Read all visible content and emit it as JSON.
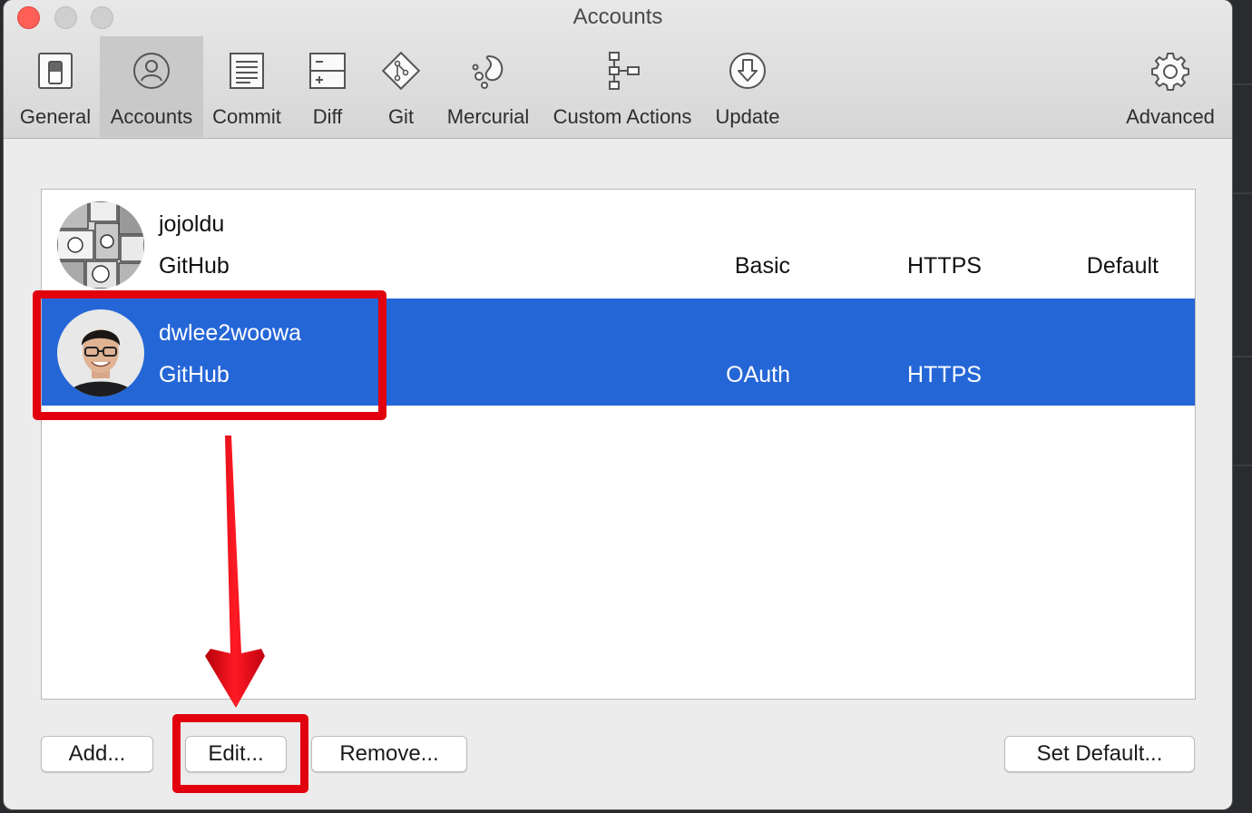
{
  "window": {
    "title": "Accounts"
  },
  "toolbar": {
    "tabs": [
      {
        "label": "General",
        "icon": "general-switch-icon"
      },
      {
        "label": "Accounts",
        "icon": "person-icon",
        "active": true
      },
      {
        "label": "Commit",
        "icon": "commit-document-icon"
      },
      {
        "label": "Diff",
        "icon": "diff-icon"
      },
      {
        "label": "Git",
        "icon": "git-icon"
      },
      {
        "label": "Mercurial",
        "icon": "mercurial-icon"
      },
      {
        "label": "Custom Actions",
        "icon": "custom-actions-icon"
      },
      {
        "label": "Update",
        "icon": "update-download-icon"
      },
      {
        "label": "Advanced",
        "icon": "gear-icon"
      }
    ]
  },
  "accounts": [
    {
      "name": "jojoldu",
      "service": "GitHub",
      "auth": "Basic",
      "protocol": "HTTPS",
      "default": "Default",
      "selected": false
    },
    {
      "name": "dwlee2woowa",
      "service": "GitHub",
      "auth": "OAuth",
      "protocol": "HTTPS",
      "default": "",
      "selected": true
    }
  ],
  "buttons": {
    "add": "Add...",
    "edit": "Edit...",
    "remove": "Remove...",
    "set_default": "Set Default..."
  },
  "colors": {
    "selection": "#2566d7",
    "annotation": "#e2000f"
  }
}
